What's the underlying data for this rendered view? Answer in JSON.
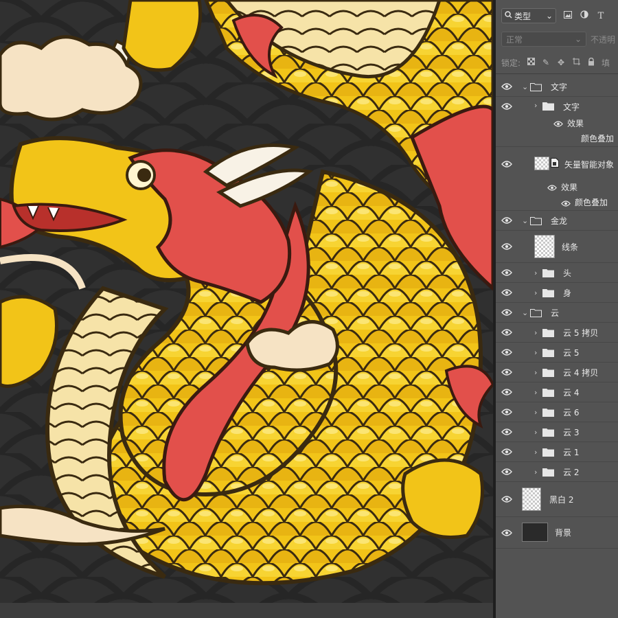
{
  "colors": {
    "canvas_background": "#2b2b2b",
    "panel_background": "#535353",
    "dragon_gold": "#f2c418",
    "dragon_red": "#e2504b",
    "cloud_cream": "#f6e3c4"
  },
  "layers_panel": {
    "filter": {
      "label": "类型",
      "icons": [
        "search-icon",
        "image-filter-icon",
        "adjustment-filter-icon",
        "text-filter-icon"
      ],
      "text_icon_glyph": "T"
    },
    "blend_mode": {
      "value": "正常",
      "opacity_label": "不透明"
    },
    "lock": {
      "label": "锁定:",
      "icons": [
        "lock-pixels-icon",
        "lock-paint-icon",
        "lock-move-icon",
        "lock-artboard-icon",
        "lock-all-icon"
      ],
      "fill_label": "填"
    },
    "layers": [
      {
        "name": "文字",
        "type": "group",
        "expanded": true
      },
      {
        "name": "文字",
        "type": "group",
        "expanded": false,
        "effects_label": "效果",
        "effect": "颜色叠加"
      },
      {
        "name": "矢量智能对象",
        "type": "smart-object",
        "effects_label": "效果",
        "effect": "颜色叠加"
      },
      {
        "name": "金龙",
        "type": "group",
        "expanded": true
      },
      {
        "name": "线条",
        "type": "pixel"
      },
      {
        "name": "头",
        "type": "group",
        "expanded": false
      },
      {
        "name": "身",
        "type": "group",
        "expanded": false
      },
      {
        "name": "云",
        "type": "group",
        "expanded": true
      },
      {
        "name": "云 5 拷贝",
        "type": "group",
        "expanded": false
      },
      {
        "name": "云 5",
        "type": "group",
        "expanded": false
      },
      {
        "name": "云 4 拷贝",
        "type": "group",
        "expanded": false
      },
      {
        "name": "云 4",
        "type": "group",
        "expanded": false
      },
      {
        "name": "云 6",
        "type": "group",
        "expanded": false
      },
      {
        "name": "云 3",
        "type": "group",
        "expanded": false
      },
      {
        "name": "云 1",
        "type": "group",
        "expanded": false
      },
      {
        "name": "云 2",
        "type": "group",
        "expanded": false
      },
      {
        "name": "黑白 2",
        "type": "adjustment"
      },
      {
        "name": "背景",
        "type": "background"
      }
    ]
  }
}
